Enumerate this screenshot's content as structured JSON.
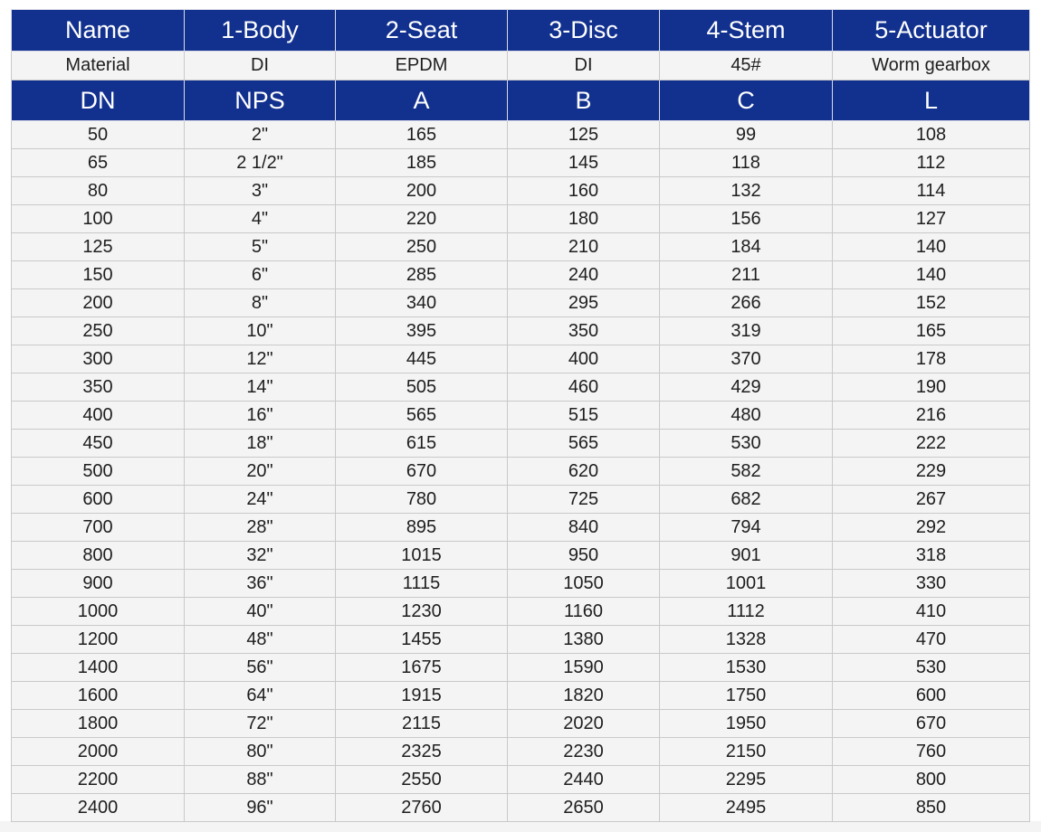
{
  "header_row": [
    "Name",
    "1-Body",
    "2-Seat",
    "3-Disc",
    "4-Stem",
    "5-Actuator"
  ],
  "material_row": [
    "Material",
    "DI",
    "EPDM",
    "DI",
    "45#",
    "Worm gearbox"
  ],
  "dimension_header_row": [
    "DN",
    "NPS",
    "A",
    "B",
    "C",
    "L"
  ],
  "rows": [
    [
      "50",
      "2\"",
      "165",
      "125",
      "99",
      "108"
    ],
    [
      "65",
      "2 1/2\"",
      "185",
      "145",
      "118",
      "112"
    ],
    [
      "80",
      "3\"",
      "200",
      "160",
      "132",
      "114"
    ],
    [
      "100",
      "4\"",
      "220",
      "180",
      "156",
      "127"
    ],
    [
      "125",
      "5\"",
      "250",
      "210",
      "184",
      "140"
    ],
    [
      "150",
      "6\"",
      "285",
      "240",
      "211",
      "140"
    ],
    [
      "200",
      "8\"",
      "340",
      "295",
      "266",
      "152"
    ],
    [
      "250",
      "10\"",
      "395",
      "350",
      "319",
      "165"
    ],
    [
      "300",
      "12\"",
      "445",
      "400",
      "370",
      "178"
    ],
    [
      "350",
      "14\"",
      "505",
      "460",
      "429",
      "190"
    ],
    [
      "400",
      "16\"",
      "565",
      "515",
      "480",
      "216"
    ],
    [
      "450",
      "18\"",
      "615",
      "565",
      "530",
      "222"
    ],
    [
      "500",
      "20\"",
      "670",
      "620",
      "582",
      "229"
    ],
    [
      "600",
      "24\"",
      "780",
      "725",
      "682",
      "267"
    ],
    [
      "700",
      "28\"",
      "895",
      "840",
      "794",
      "292"
    ],
    [
      "800",
      "32\"",
      "1015",
      "950",
      "901",
      "318"
    ],
    [
      "900",
      "36\"",
      "1115",
      "1050",
      "1001",
      "330"
    ],
    [
      "1000",
      "40\"",
      "1230",
      "1160",
      "1112",
      "410"
    ],
    [
      "1200",
      "48\"",
      "1455",
      "1380",
      "1328",
      "470"
    ],
    [
      "1400",
      "56\"",
      "1675",
      "1590",
      "1530",
      "530"
    ],
    [
      "1600",
      "64\"",
      "1915",
      "1820",
      "1750",
      "600"
    ],
    [
      "1800",
      "72\"",
      "2115",
      "2020",
      "1950",
      "670"
    ],
    [
      "2000",
      "80\"",
      "2325",
      "2230",
      "2150",
      "760"
    ],
    [
      "2200",
      "88\"",
      "2550",
      "2440",
      "2295",
      "800"
    ],
    [
      "2400",
      "96\"",
      "2760",
      "2650",
      "2495",
      "850"
    ]
  ],
  "colors": {
    "header_background": "#12318f",
    "header_text": "#ffffff",
    "cell_background": "#f4f4f5",
    "border": "#c9c9c9"
  }
}
